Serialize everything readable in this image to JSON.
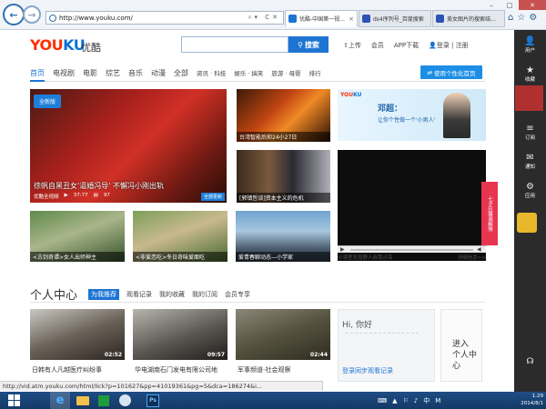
{
  "browser": {
    "url": "http://www.youku.com/",
    "tabs": [
      {
        "label": "优酷-中国第一视...",
        "favicon_color": "#1d74d3",
        "active": true
      },
      {
        "label": "ds4序列号_百度搜索",
        "favicon_color": "#2d52b7",
        "active": false
      },
      {
        "label": "美女图片的搜索结...",
        "favicon_color": "#2d52b7",
        "active": false
      }
    ],
    "caption_buttons": [
      "–",
      "□",
      "✕"
    ],
    "status_url": "http://vid.atm.youku.com/html/lick?p=101627&pp=41019361&pg=5&dca=186274&i..."
  },
  "site": {
    "logo_main": "YOUKU",
    "logo_sub": "优酷",
    "search": {
      "placeholder": "",
      "button": "搜索"
    },
    "top_links": [
      "上传",
      "会员",
      "APP下载",
      "登录",
      "注册"
    ],
    "nav": [
      "首页",
      "电视剧",
      "电影",
      "综艺",
      "音乐",
      "动漫",
      "全部",
      "资讯 · 科技",
      "娱乐 · 搞笑",
      "旅游 · 母婴",
      "排行"
    ],
    "channel_button": "使用个性化首页",
    "brand_color": "#1d74d3"
  },
  "feature": {
    "badge": "全新版",
    "title": "徐帆自黑丑女'逼婚冯导' 不懈冯小刚出轨",
    "meta": [
      "优酷全视频",
      "37:77",
      "97"
    ],
    "label": "全部更新"
  },
  "tiles": [
    {
      "caption": "台湾智能后抑24小27日",
      "bg": "linear-gradient(135deg,#3a1a08,#c14512 40%,#f08a26 60%,#2a1005)"
    },
    {
      "caption": "[郭镇哲谈]资本主义的危机",
      "bg": "linear-gradient(90deg,#3b2a1c,#7a5a3f 35%,#2a2a32 60%,#b0b0b8)"
    },
    {
      "caption": "<古剑奇谭>女人出师神主",
      "bg": "linear-gradient(160deg,#5e8a4a,#a9b58a 45%,#38542c)"
    },
    {
      "caption": "<非爱恋吃>冬日奇味爱面吃",
      "bg": "linear-gradient(160deg,#7c9f5a,#c8b98e 45%,#4a6a32)"
    },
    {
      "caption": "爱青春聊动态—小学家",
      "bg": "linear-gradient(180deg,#6ea3d0,#a8c7df 40%,#4a5a6c 75%,#2e3a45)"
    }
  ],
  "ad": {
    "headline": "邓超：",
    "subline": "让你个性做一个'小男人'",
    "video_caption": "沙漠里发现野人自我点亮",
    "video_link": "详细信息>>",
    "tag": "七夕应援谁解情"
  },
  "personal": {
    "title": "个人中心",
    "tabs": [
      "为我推荐",
      "观看记录",
      "我的收藏",
      "我的订阅",
      "会员专享"
    ],
    "videos": [
      {
        "title": "日韩有人凡越医疗纠纷事",
        "duration": "02:52",
        "bg": "linear-gradient(160deg,#c9c7c2,#6a6258 50%,#2b2420)"
      },
      {
        "title": "华电湖南石门发电有限公司地",
        "duration": "09:57",
        "bg": "linear-gradient(160deg,#b8b4ae,#5a5651 55%,#1f1d1b)"
      },
      {
        "title": "军事频道-社会观察",
        "duration": "02:44",
        "bg": "linear-gradient(160deg,#8a8778,#54523e 50%,#2e2b20)"
      }
    ],
    "greeting": "Hi, 你好",
    "login_text": "登录同步观看记录",
    "join_text": "进入\n个人中\n心"
  },
  "sidebar": [
    {
      "icon": "👤",
      "label": "用户"
    },
    {
      "icon": "★",
      "label": "收藏"
    },
    {
      "icon": "◷",
      "label": "记录"
    },
    {
      "icon": "≡",
      "label": "订阅"
    },
    {
      "icon": "✉",
      "label": "通知"
    },
    {
      "icon": "⚙",
      "label": "应用"
    }
  ],
  "taskbar": {
    "start_color": "#ffffff",
    "clock_time": "1:29",
    "clock_date": "2014/8/1",
    "tray": [
      "⌨",
      "▲",
      "⚐",
      "♪",
      "中",
      "M"
    ]
  }
}
